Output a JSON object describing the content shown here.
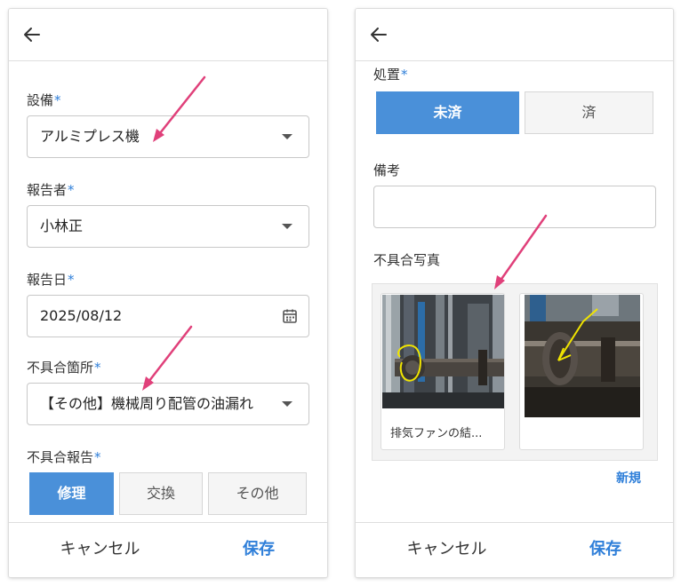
{
  "left": {
    "fields": {
      "equipment": {
        "label": "設備",
        "required_mark": "*",
        "value": "アルミプレス機"
      },
      "reporter": {
        "label": "報告者",
        "required_mark": "*",
        "value": "小林正"
      },
      "report_date": {
        "label": "報告日",
        "required_mark": "*",
        "value": "2025/08/12"
      },
      "defect_location": {
        "label": "不具合箇所",
        "required_mark": "*",
        "value": "【その他】機械周り配管の油漏れ"
      },
      "defect_report": {
        "label": "不具合報告",
        "required_mark": "*",
        "options": [
          "修理",
          "交換",
          "その他"
        ],
        "selected": "修理"
      }
    },
    "footer": {
      "cancel_label": "キャンセル",
      "save_label": "保存"
    }
  },
  "right": {
    "fields": {
      "treatment": {
        "label": "処置",
        "required_mark": "*",
        "options": [
          "未済",
          "済"
        ],
        "selected": "未済"
      },
      "remarks": {
        "label": "備考",
        "value": ""
      },
      "photos": {
        "label": "不具合写真",
        "items": [
          {
            "caption": "排気ファンの結..."
          },
          {
            "caption": ""
          }
        ],
        "new_label": "新規"
      }
    },
    "footer": {
      "cancel_label": "キャンセル",
      "save_label": "保存"
    }
  },
  "colors": {
    "accent": "#2f7fd9",
    "active_segment": "#4a90d9",
    "annotation_arrow": "#e0407a"
  },
  "icons": [
    "back-arrow-icon",
    "dropdown-caret-icon",
    "calendar-icon"
  ]
}
